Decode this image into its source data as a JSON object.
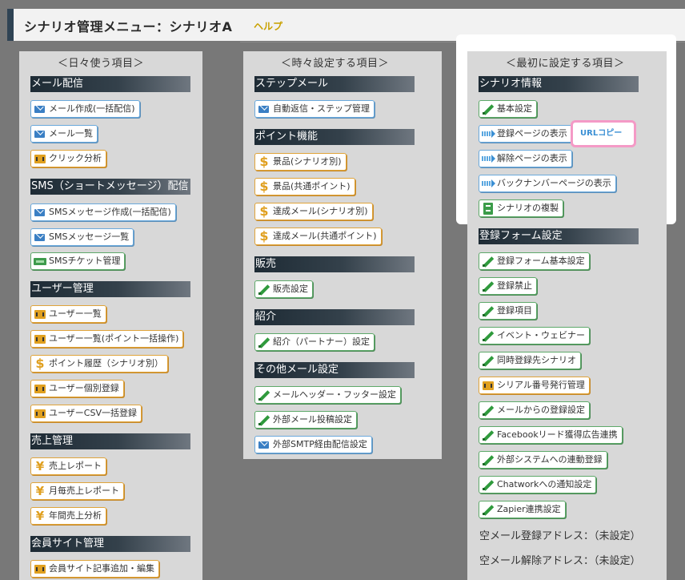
{
  "header": {
    "title": "シナリオ管理メニュー：シナリオA",
    "help_label": "ヘルプ"
  },
  "columns": {
    "daily": {
      "heading": "＜日々使う項目＞",
      "sections": [
        {
          "title": "メール配信",
          "items": [
            {
              "label": "メール作成(一括配信)",
              "icon": "mail-icon",
              "color": "#6aa9dc"
            },
            {
              "label": "メール一覧",
              "icon": "mail-icon",
              "color": "#6aa9dc"
            },
            {
              "label": "クリック分析",
              "icon": "chart-icon",
              "color": "#e0a43a"
            }
          ]
        },
        {
          "title": "SMS（ショートメッセージ）配信",
          "items": [
            {
              "label": "SMSメッセージ作成(一括配信)",
              "icon": "mail-icon",
              "color": "#6aa9dc"
            },
            {
              "label": "SMSメッセージ一覧",
              "icon": "mail-icon",
              "color": "#6aa9dc"
            },
            {
              "label": "SMSチケット管理",
              "icon": "ticket-icon",
              "color": "#5ea96a"
            }
          ]
        },
        {
          "title": "ユーザー管理",
          "items": [
            {
              "label": "ユーザー一覧",
              "icon": "chart-icon",
              "color": "#e0a43a"
            },
            {
              "label": "ユーザー一覧(ポイント一括操作)",
              "icon": "chart-icon",
              "color": "#e0a43a"
            },
            {
              "label": "ポイント履歴（シナリオ別）",
              "icon": "dollar-icon",
              "color": "#e0a43a"
            },
            {
              "label": "ユーザー個別登録",
              "icon": "chart-icon",
              "color": "#e0a43a"
            },
            {
              "label": "ユーザーCSV一括登録",
              "icon": "chart-icon",
              "color": "#e0a43a"
            }
          ]
        },
        {
          "title": "売上管理",
          "items": [
            {
              "label": "売上レポート",
              "icon": "yen-icon",
              "color": "#e0a43a"
            },
            {
              "label": "月毎売上レポート",
              "icon": "yen-icon",
              "color": "#e0a43a"
            },
            {
              "label": "年間売上分析",
              "icon": "yen-icon",
              "color": "#e0a43a"
            }
          ]
        },
        {
          "title": "会員サイト管理",
          "items": [
            {
              "label": "会員サイト記事追加・編集",
              "icon": "chart-icon",
              "color": "#e0a43a"
            }
          ]
        }
      ]
    },
    "occasional": {
      "heading": "＜時々設定する項目＞",
      "sections": [
        {
          "title": "ステップメール",
          "items": [
            {
              "label": "自動返信・ステップ管理",
              "icon": "mail-icon",
              "color": "#6aa9dc"
            }
          ]
        },
        {
          "title": "ポイント機能",
          "items": [
            {
              "label": "景品(シナリオ別)",
              "icon": "dollar-icon",
              "color": "#e0a43a"
            },
            {
              "label": "景品(共通ポイント)",
              "icon": "dollar-icon",
              "color": "#e0a43a"
            },
            {
              "label": "達成メール(シナリオ別)",
              "icon": "dollar-icon",
              "color": "#e0a43a"
            },
            {
              "label": "達成メール(共通ポイント)",
              "icon": "dollar-icon",
              "color": "#e0a43a"
            }
          ]
        },
        {
          "title": "販売",
          "items": [
            {
              "label": "販売設定",
              "icon": "pencil-icon",
              "color": "#5ea96a"
            }
          ]
        },
        {
          "title": "紹介",
          "items": [
            {
              "label": "紹介（パートナー）設定",
              "icon": "pencil-icon",
              "color": "#5ea96a"
            }
          ]
        },
        {
          "title": "その他メール設定",
          "items": [
            {
              "label": "メールヘッダー・フッター設定",
              "icon": "pencil-icon",
              "color": "#5ea96a"
            },
            {
              "label": "外部メール投稿設定",
              "icon": "pencil-icon",
              "color": "#5ea96a"
            },
            {
              "label": "外部SMTP経由配信設定",
              "icon": "mail-icon",
              "color": "#6aa9dc"
            }
          ]
        }
      ]
    },
    "initial": {
      "heading": "＜最初に設定する項目＞",
      "sections": [
        {
          "title": "シナリオ情報",
          "items": [
            {
              "label": "基本設定",
              "icon": "pencil-icon",
              "color": "#5ea96a"
            },
            {
              "label": "登録ページの表示",
              "icon": "arrow-icon",
              "color": "#6aa9dc"
            },
            {
              "label": "解除ページの表示",
              "icon": "arrow-icon",
              "color": "#6aa9dc"
            },
            {
              "label": "バックナンバーページの表示",
              "icon": "arrow-icon",
              "color": "#6aa9dc"
            },
            {
              "label": "シナリオの複製",
              "icon": "copy-icon",
              "color": "#5ea96a"
            }
          ],
          "url_copy_label": "URLコピー"
        },
        {
          "title": "登録フォーム設定",
          "items": [
            {
              "label": "登録フォーム基本設定",
              "icon": "pencil-icon",
              "color": "#5ea96a"
            },
            {
              "label": "登録禁止",
              "icon": "pencil-icon",
              "color": "#5ea96a"
            },
            {
              "label": "登録項目",
              "icon": "pencil-icon",
              "color": "#5ea96a"
            },
            {
              "label": "イベント・ウェビナー",
              "icon": "pencil-icon",
              "color": "#5ea96a"
            },
            {
              "label": "同時登録先シナリオ",
              "icon": "pencil-icon",
              "color": "#5ea96a"
            },
            {
              "label": "シリアル番号発行管理",
              "icon": "chart-icon",
              "color": "#e0a43a"
            },
            {
              "label": "メールからの登録設定",
              "icon": "pencil-icon",
              "color": "#5ea96a"
            },
            {
              "label": "Facebookリード獲得広告連携",
              "icon": "pencil-icon",
              "color": "#5ea96a"
            },
            {
              "label": "外部システムへの連動登録",
              "icon": "pencil-icon",
              "color": "#5ea96a"
            },
            {
              "label": "Chatworkへの通知設定",
              "icon": "pencil-icon",
              "color": "#5ea96a"
            },
            {
              "label": "Zapier連携設定",
              "icon": "pencil-icon",
              "color": "#5ea96a"
            }
          ],
          "empty_mail_register": "空メール登録アドレス：（未設定）",
          "empty_mail_unsubscribe": "空メール解除アドレス：（未設定）"
        }
      ]
    }
  }
}
